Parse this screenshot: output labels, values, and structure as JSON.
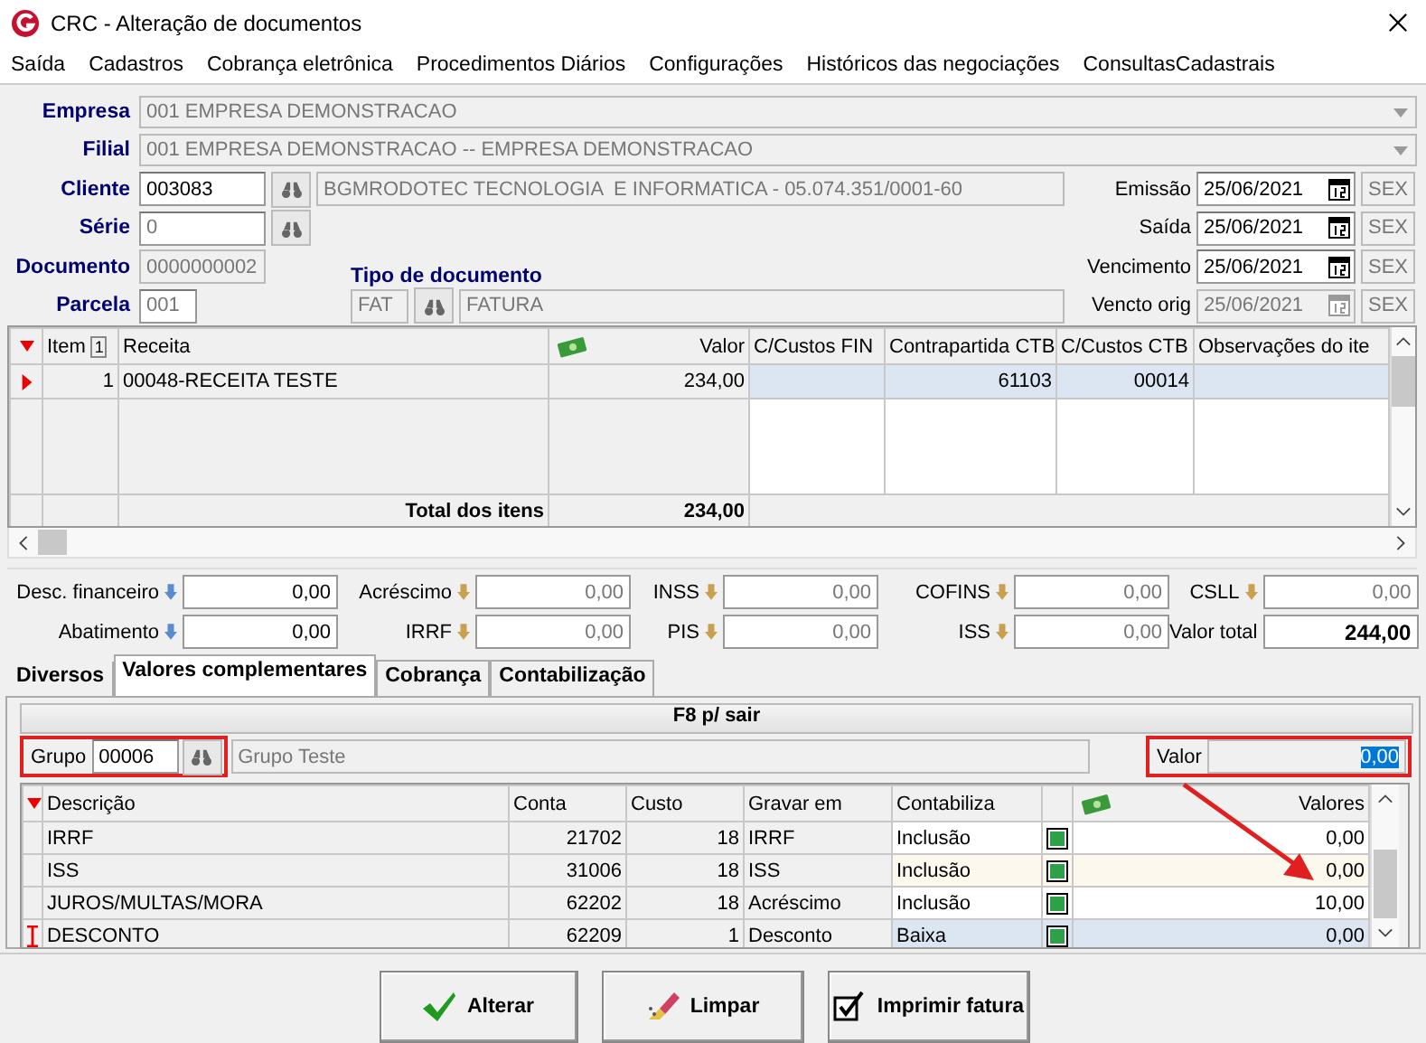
{
  "window": {
    "title": "CRC - Alteração de documentos"
  },
  "menu": [
    "Saída",
    "Cadastros",
    "Cobrança eletrônica",
    "Procedimentos Diários",
    "Configurações",
    "Históricos das negociações",
    "ConsultasCadastrais"
  ],
  "empresa": {
    "label": "Empresa",
    "value": "001 EMPRESA DEMONSTRACAO"
  },
  "filial": {
    "label": "Filial",
    "value": "001 EMPRESA DEMONSTRACAO -- EMPRESA DEMONSTRACAO"
  },
  "cliente": {
    "label": "Cliente",
    "code": "003083",
    "name": "BGMRODOTEC TECNOLOGIA  E INFORMATICA - 05.074.351/0001-60"
  },
  "serie": {
    "label": "Série",
    "value": "0"
  },
  "documento": {
    "label": "Documento",
    "value": "0000000002"
  },
  "parcela": {
    "label": "Parcela",
    "value": "001"
  },
  "tipo_documento": {
    "label": "Tipo de documento",
    "code": "FAT",
    "name": "FATURA"
  },
  "dates": [
    {
      "label": "Emissão",
      "value": "25/06/2021",
      "day": "SEX",
      "disabled": false
    },
    {
      "label": "Saída",
      "value": "25/06/2021",
      "day": "SEX",
      "disabled": false
    },
    {
      "label": "Vencimento",
      "value": "25/06/2021",
      "day": "SEX",
      "disabled": false
    },
    {
      "label": "Vencto orig",
      "value": "25/06/2021",
      "day": "SEX",
      "disabled": true
    }
  ],
  "items": {
    "columns": [
      {
        "label": "Item",
        "sort": "1"
      },
      {
        "label": "Receita"
      },
      {
        "label": "Valor",
        "kind": "money"
      },
      {
        "label": "C/Custos FIN"
      },
      {
        "label": "Contrapartida CTB"
      },
      {
        "label": "C/Custos CTB"
      },
      {
        "label": "Observações do ite"
      }
    ],
    "rows": [
      {
        "cells": [
          "1",
          "00048-RECEITA TESTE",
          "234,00",
          "",
          "61103",
          "00014",
          ""
        ],
        "selected": true
      }
    ],
    "total_label": "Total dos itens",
    "total": "234,00"
  },
  "taxes": [
    {
      "label": "Desc. financeiro",
      "value": "0,00",
      "kind": "editable"
    },
    {
      "label": "Acréscimo",
      "value": "0,00",
      "kind": "readonly"
    },
    {
      "label": "INSS",
      "value": "0,00",
      "kind": "readonly"
    },
    {
      "label": "COFINS",
      "value": "0,00",
      "kind": "readonly"
    },
    {
      "label": "CSLL",
      "value": "0,00",
      "kind": "readonly"
    },
    {
      "label": "Abatimento",
      "value": "0,00",
      "kind": "editable"
    },
    {
      "label": "IRRF",
      "value": "0,00",
      "kind": "readonly"
    },
    {
      "label": "PIS",
      "value": "0,00",
      "kind": "readonly"
    },
    {
      "label": "ISS",
      "value": "0,00",
      "kind": "readonly"
    },
    {
      "label": "Valor total",
      "value": "244,00",
      "kind": "total"
    }
  ],
  "tabs": [
    {
      "label": "Diversos",
      "selected": false
    },
    {
      "label": "Valores complementares",
      "selected": true
    },
    {
      "label": "Cobrança",
      "selected": false
    },
    {
      "label": "Contabilização",
      "selected": false
    }
  ],
  "panel": {
    "hint": "F8 p/ sair",
    "grupo": {
      "label": "Grupo",
      "code": "00006",
      "name": "Grupo Teste"
    },
    "valor": {
      "label": "Valor",
      "value": "0,00"
    },
    "columns": [
      "Descrição",
      "Conta",
      "Custo",
      "Gravar em",
      "Contabiliza",
      "",
      "Valores"
    ],
    "rows": [
      {
        "descricao": "IRRF",
        "conta": "21702",
        "custo": "18",
        "gravar": "IRRF",
        "contabiliza": "Inclusão",
        "checked": true,
        "valor": "0,00",
        "selected": false
      },
      {
        "descricao": "ISS",
        "conta": "31006",
        "custo": "18",
        "gravar": "ISS",
        "contabiliza": "Inclusão",
        "checked": true,
        "valor": "0,00",
        "selected": false
      },
      {
        "descricao": "JUROS/MULTAS/MORA",
        "conta": "62202",
        "custo": "18",
        "gravar": "Acréscimo",
        "contabiliza": "Inclusão",
        "checked": true,
        "valor": "10,00",
        "selected": false
      },
      {
        "descricao": "DESCONTO",
        "conta": "62209",
        "custo": "1",
        "gravar": "Desconto",
        "contabiliza": "Baixa",
        "checked": true,
        "valor": "0,00",
        "selected": true
      }
    ]
  },
  "buttons": [
    {
      "label": "Alterar",
      "kind": "confirm"
    },
    {
      "label": "Limpar",
      "kind": "clear"
    },
    {
      "label": "Imprimir fatura",
      "kind": "print"
    }
  ]
}
